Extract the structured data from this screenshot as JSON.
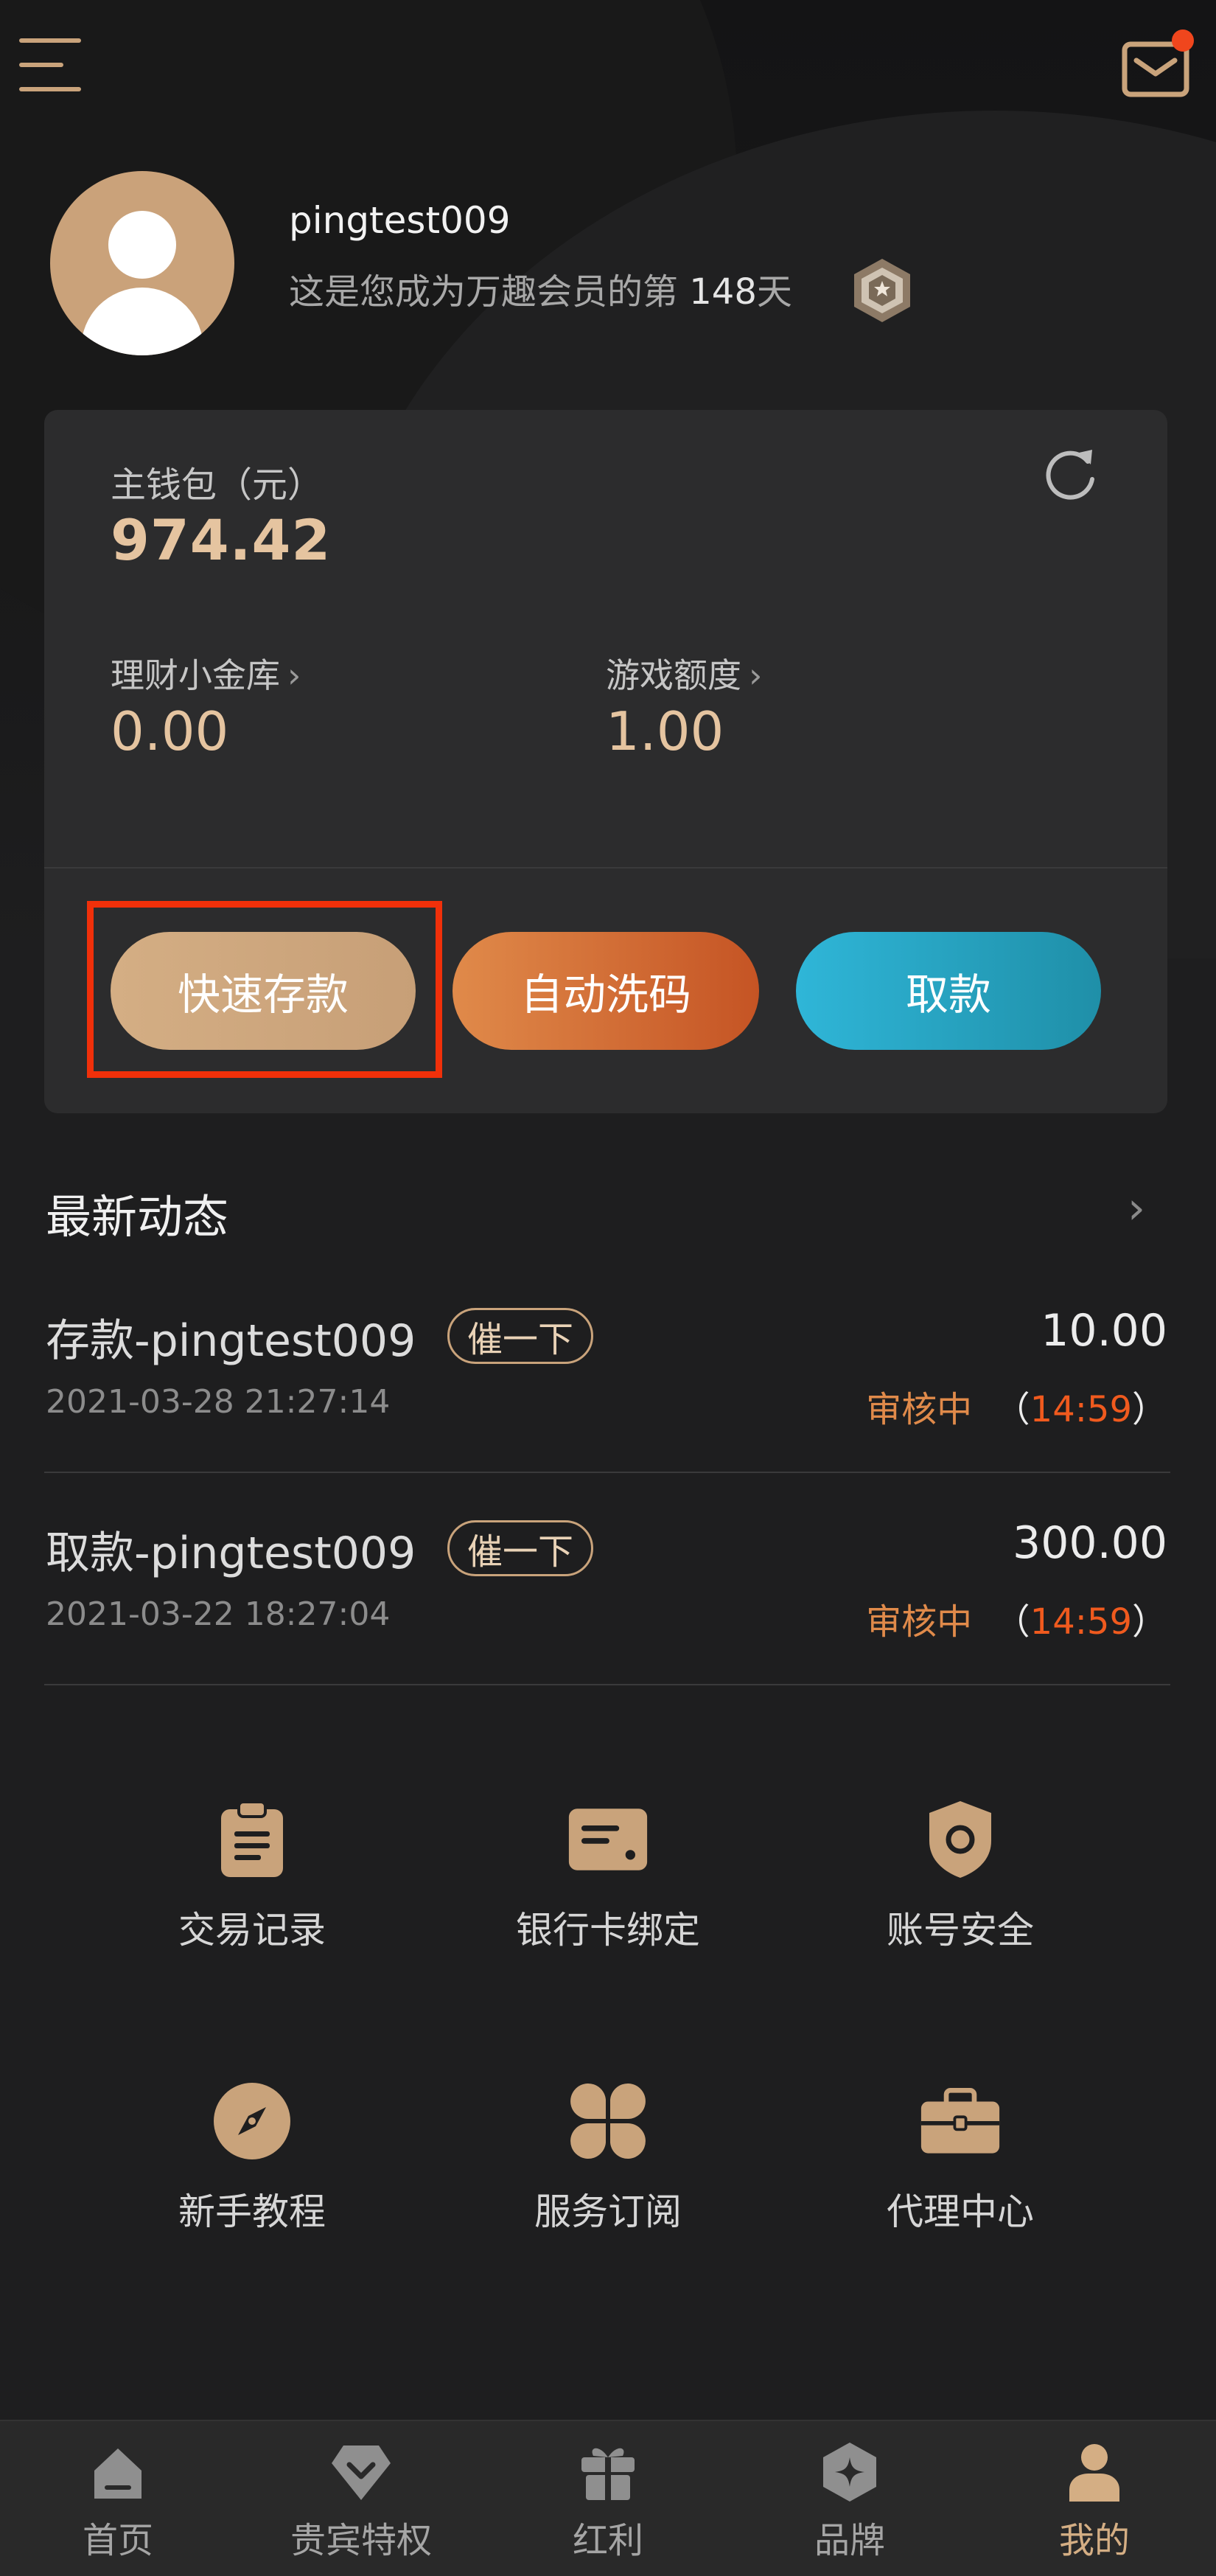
{
  "header": {
    "notification_badge": true
  },
  "profile": {
    "username": "pingtest009",
    "member_prefix": "这是您成为万趣会员的第 ",
    "member_days": "148",
    "member_suffix": "天"
  },
  "wallet": {
    "main_label": "主钱包（元）",
    "main_amount": "974.42",
    "vault_label": "理财小金库",
    "vault_amount": "0.00",
    "game_label": "游戏额度",
    "game_amount": "1.00",
    "chevron": "›"
  },
  "actions": {
    "deposit": "快速存款",
    "rebate": "自动洗码",
    "withdraw": "取款"
  },
  "activity": {
    "title": "最新动态",
    "chevron": "›",
    "items": [
      {
        "title": "存款-pingtest009",
        "urge": "催一下",
        "amount": "10.00",
        "date": "2021-03-28 21:27:14",
        "status": "审核中",
        "open_paren": "（",
        "timer": "14:59",
        "close_paren": "）"
      },
      {
        "title": "取款-pingtest009",
        "urge": "催一下",
        "amount": "300.00",
        "date": "2021-03-22 18:27:04",
        "status": "审核中",
        "open_paren": "（",
        "timer": "14:59",
        "close_paren": "）"
      }
    ]
  },
  "features": [
    {
      "label": "交易记录",
      "icon": "clipboard-icon"
    },
    {
      "label": "银行卡绑定",
      "icon": "bank-card-icon"
    },
    {
      "label": "账号安全",
      "icon": "shield-icon"
    },
    {
      "label": "新手教程",
      "icon": "compass-icon"
    },
    {
      "label": "服务订阅",
      "icon": "clover-icon"
    },
    {
      "label": "代理中心",
      "icon": "briefcase-icon"
    }
  ],
  "tabs": [
    {
      "label": "首页",
      "icon": "home-icon",
      "active": false
    },
    {
      "label": "贵宾特权",
      "icon": "diamond-icon",
      "active": false
    },
    {
      "label": "红利",
      "icon": "gift-icon",
      "active": false
    },
    {
      "label": "品牌",
      "icon": "brand-icon",
      "active": false
    },
    {
      "label": "我的",
      "icon": "user-icon",
      "active": true
    }
  ],
  "colors": {
    "gold": "#c9a37b",
    "accent_orange": "#e08a4a",
    "accent_blue": "#2fb6d8",
    "highlight_red": "#f0300a",
    "background": "#1e1e1f",
    "card": "#2c2c2d"
  }
}
